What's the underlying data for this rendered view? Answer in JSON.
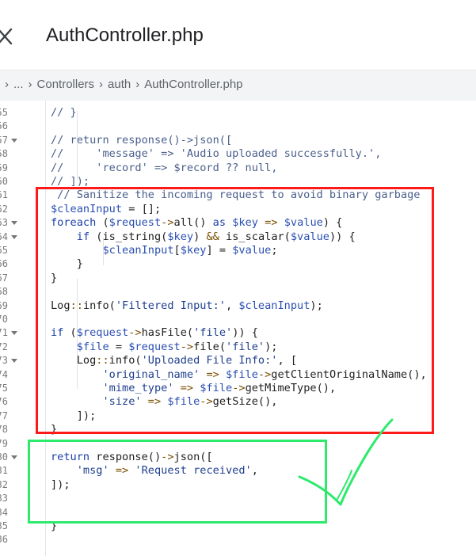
{
  "window": {
    "title": "AuthController.php",
    "close_icon": "close-icon"
  },
  "breadcrumb": {
    "items": [
      "...",
      "Controllers",
      "auth",
      "AuthController.php"
    ],
    "separator": "›"
  },
  "editor": {
    "lines": [
      {
        "num": "55",
        "text": "// }"
      },
      {
        "num": "56",
        "text": ""
      },
      {
        "num": "57",
        "text": "// return response()->json(["
      },
      {
        "num": "58",
        "text": "//     'message' => 'Audio uploaded successfully.',"
      },
      {
        "num": "59",
        "text": "//     'record' => $record ?? null,"
      },
      {
        "num": "60",
        "text": "// ]);"
      },
      {
        "num": "61",
        "text": " // Sanitize the incoming request to avoid binary garbage"
      },
      {
        "num": "62",
        "text": "$cleanInput = [];"
      },
      {
        "num": "63",
        "text": "foreach ($request->all() as $key => $value) {"
      },
      {
        "num": "64",
        "text": "    if (is_string($key) && is_scalar($value)) {"
      },
      {
        "num": "65",
        "text": "        $cleanInput[$key] = $value;"
      },
      {
        "num": "66",
        "text": "    }"
      },
      {
        "num": "67",
        "text": "}"
      },
      {
        "num": "68",
        "text": ""
      },
      {
        "num": "69",
        "text": "Log::info('Filtered Input:', $cleanInput);"
      },
      {
        "num": "70",
        "text": ""
      },
      {
        "num": "71",
        "text": "if ($request->hasFile('file')) {"
      },
      {
        "num": "72",
        "text": "    $file = $request->file('file');"
      },
      {
        "num": "73",
        "text": "    Log::info('Uploaded File Info:', ["
      },
      {
        "num": "74",
        "text": "        'original_name' => $file->getClientOriginalName(),"
      },
      {
        "num": "75",
        "text": "        'mime_type' => $file->getMimeType(),"
      },
      {
        "num": "76",
        "text": "        'size' => $file->getSize(),"
      },
      {
        "num": "77",
        "text": "    ]);"
      },
      {
        "num": "78",
        "text": "}"
      },
      {
        "num": "79",
        "text": ""
      },
      {
        "num": "80",
        "text": "return response()->json(["
      },
      {
        "num": "81",
        "text": "    'msg' => 'Request received',"
      },
      {
        "num": "82",
        "text": "]);"
      },
      {
        "num": "83",
        "text": ""
      },
      {
        "num": "84",
        "text": ""
      },
      {
        "num": "85",
        "text": "}"
      },
      {
        "num": "86",
        "text": ""
      }
    ],
    "folded_lines": [
      "57",
      "63",
      "64",
      "71",
      "73",
      "80"
    ]
  },
  "annotations": {
    "red_box_color": "#ff1a1a",
    "green_box_color": "#2dea6b",
    "checkmark_color": "#2dea6b"
  }
}
